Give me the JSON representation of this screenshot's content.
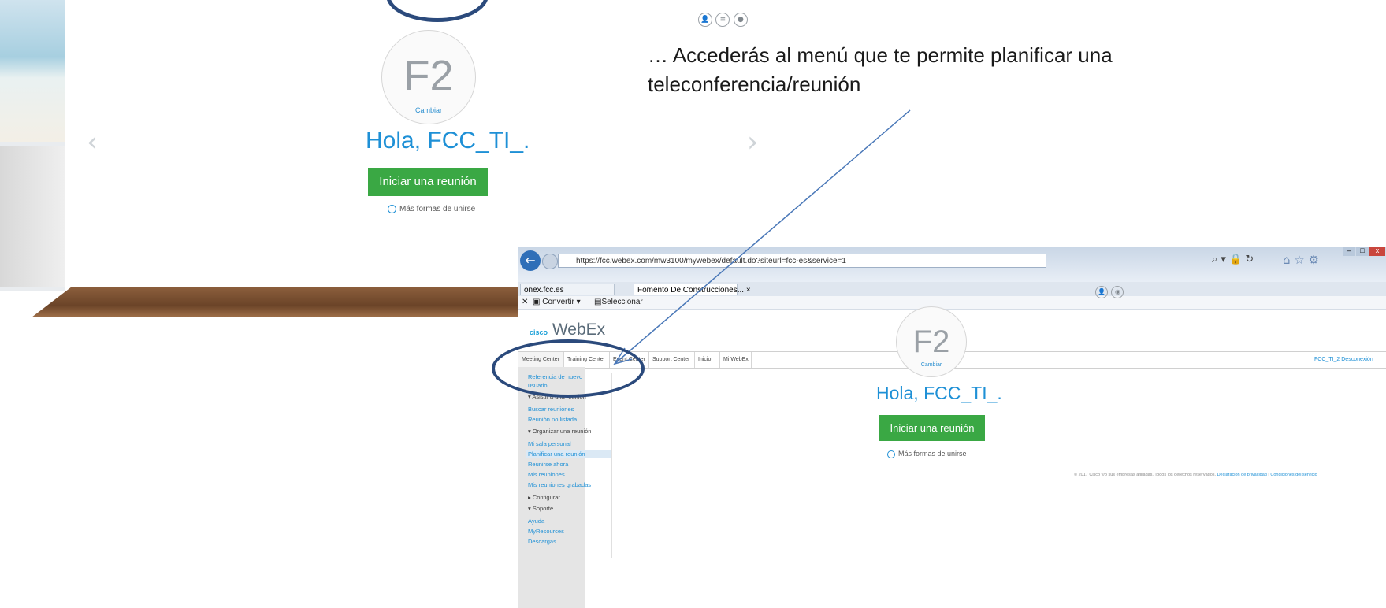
{
  "background": {
    "avatar": {
      "initials": "F2",
      "change_label": "Cambiar"
    },
    "greeting": "Hola, FCC_TI_.",
    "start_button": "Iniciar una reunión",
    "more_ways": "Más formas de unirse",
    "prev_arrow": "‹",
    "next_arrow": "›"
  },
  "annotation": {
    "text": "… Accederás al menú que te permite planificar una teleconferencia/reunión"
  },
  "browser": {
    "url": "https://fcc.webex.com/mw3100/mywebex/default.do?siteurl=fcc-es&service=1",
    "tabs": [
      "onex.fcc.es",
      "Fomento De Construcciones..."
    ],
    "tab_close": "×",
    "commands": {
      "convert": "Convertir",
      "select": "Seleccionar"
    },
    "window_buttons": [
      "–",
      "□",
      "x"
    ],
    "logo": {
      "cisco": "cisco",
      "product": "WebEx"
    },
    "nav_tabs": [
      "Meeting Center",
      "Training Center",
      "Event Center",
      "Support Center",
      "Inicio",
      "Mi WebEx"
    ],
    "user": {
      "name": "FCC_TI_2",
      "logout": "Desconexión"
    },
    "menu": [
      {
        "label": "Referencia de nuevo usuario",
        "type": "link"
      },
      {
        "label": "▾ Asistir a una reunión",
        "type": "section"
      },
      {
        "label": "Buscar reuniones",
        "type": "link"
      },
      {
        "label": "Reunión no listada",
        "type": "link"
      },
      {
        "label": "▾ Organizar una reunión",
        "type": "section"
      },
      {
        "label": "Mi sala personal",
        "type": "link"
      },
      {
        "label": "Planificar una reunión",
        "type": "link",
        "active": true
      },
      {
        "label": "Reunirse ahora",
        "type": "link"
      },
      {
        "label": "Mis reuniones",
        "type": "link"
      },
      {
        "label": "Mis reuniones grabadas",
        "type": "link"
      },
      {
        "label": "▸ Configurar",
        "type": "section"
      },
      {
        "label": "▾ Soporte",
        "type": "section"
      },
      {
        "label": "Ayuda",
        "type": "link"
      },
      {
        "label": "MyResources",
        "type": "link"
      },
      {
        "label": "Descargas",
        "type": "link"
      }
    ],
    "main": {
      "avatar": {
        "initials": "F2",
        "change_label": "Cambiar"
      },
      "greeting": "Hola, FCC_TI_.",
      "start_button": "Iniciar una reunión",
      "more_ways": "Más formas de unirse"
    },
    "footer": {
      "text": "© 2017 Cisco y/o sus empresas afiliadas. Todos los derechos reservados.",
      "privacy": "Declaración de privacidad",
      "separator": "|",
      "terms": "Condiciones del servicio"
    }
  },
  "colors": {
    "accent_blue": "#1e90d6",
    "start_green": "#3aa844",
    "annotation_ellipse": "#2b4a7c"
  }
}
